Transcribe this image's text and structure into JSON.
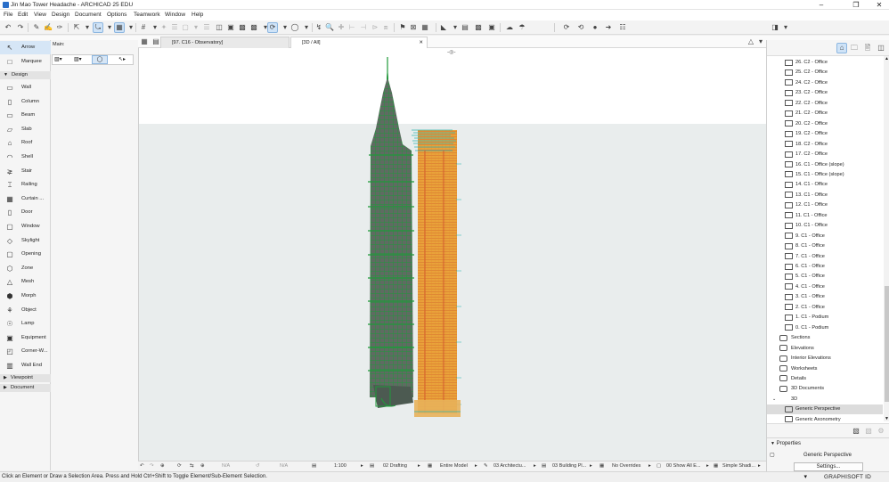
{
  "window": {
    "title": "Jin Mao Tower Headache - ARCHICAD 25 EDU",
    "controls": [
      "minimize",
      "maximize",
      "close"
    ]
  },
  "menu": [
    "File",
    "Edit",
    "View",
    "Design",
    "Document",
    "Options",
    "Teamwork",
    "Window",
    "Help"
  ],
  "tabs": [
    {
      "label": "[97. C16 - Observatory]",
      "active": false
    },
    {
      "label": "[3D / All]",
      "active": true
    }
  ],
  "toolbox": {
    "select_tools": [
      {
        "label": "Arrow",
        "icon": "arrow-icon",
        "selected": true
      },
      {
        "label": "Marquee",
        "icon": "marquee-icon",
        "selected": false
      }
    ],
    "design_header": "Design",
    "design_tools": [
      {
        "label": "Wall",
        "icon": "wall-icon"
      },
      {
        "label": "Column",
        "icon": "column-icon"
      },
      {
        "label": "Beam",
        "icon": "beam-icon"
      },
      {
        "label": "Slab",
        "icon": "slab-icon"
      },
      {
        "label": "Roof",
        "icon": "roof-icon"
      },
      {
        "label": "Shell",
        "icon": "shell-icon"
      },
      {
        "label": "Stair",
        "icon": "stair-icon"
      },
      {
        "label": "Railing",
        "icon": "railing-icon"
      },
      {
        "label": "Curtain ...",
        "icon": "curtain-wall-icon"
      },
      {
        "label": "Door",
        "icon": "door-icon"
      },
      {
        "label": "Window",
        "icon": "window-icon"
      },
      {
        "label": "Skylight",
        "icon": "skylight-icon"
      },
      {
        "label": "Opening",
        "icon": "opening-icon"
      },
      {
        "label": "Zone",
        "icon": "zone-icon"
      },
      {
        "label": "Mesh",
        "icon": "mesh-icon"
      },
      {
        "label": "Morph",
        "icon": "morph-icon"
      },
      {
        "label": "Object",
        "icon": "object-icon"
      },
      {
        "label": "Lamp",
        "icon": "lamp-icon"
      },
      {
        "label": "Equipment",
        "icon": "equipment-icon"
      },
      {
        "label": "Corner-W...",
        "icon": "corner-window-icon"
      },
      {
        "label": "Wall End",
        "icon": "wall-end-icon"
      }
    ],
    "viewpoint_header": "Viewpoint",
    "document_header": "Document"
  },
  "infobox": {
    "label": "Main:"
  },
  "navigator": {
    "stories": [
      "26. C2 - Office",
      "25. C2 - Office",
      "24. C2 - Office",
      "23. C2 - Office",
      "22. C2 - Office",
      "21. C2 - Office",
      "20. C2 - Office",
      "19. C2 - Office",
      "18. C2 - Office",
      "17. C2 - Office",
      "16. C1 - Office (slope)",
      "15. C1 - Office (slope)",
      "14. C1 - Office",
      "13. C1 - Office",
      "12. C1 - Office",
      "11. C1 - Office",
      "10. C1 - Office",
      "9. C1 - Office",
      "8. C1 - Office",
      "7. C1 - Office",
      "6. C1 - Office",
      "5. C1 - Office",
      "4. C1 - Office",
      "3. C1 - Office",
      "2. C1 - Office",
      "1. C1 - Podium",
      "0. C1 - Podium"
    ],
    "groups": [
      "Sections",
      "Elevations",
      "Interior Elevations",
      "Worksheets",
      "Details",
      "3D Documents",
      "3D"
    ],
    "views_3d": [
      {
        "label": "Generic Perspective",
        "selected": true
      },
      {
        "label": "Generic Axonometry",
        "selected": false
      }
    ]
  },
  "properties": {
    "header": "Properties",
    "value": "Generic Perspective",
    "settings_label": "Settings..."
  },
  "viewbar": {
    "scale_na_1": "N/A",
    "scale_na_2": "N/A",
    "scale": "1:100",
    "layer_combo": "02 Drafting",
    "model_view": "Entire Model",
    "pen_set": "03 Architectu...",
    "mvo": "03 Building Pl...",
    "override": "No Overrides",
    "renovation": "00 Show All E...",
    "shading": "Simple Shadi..."
  },
  "status": {
    "message": "Click an Element or Draw a Selection Area. Press and Hold Ctrl+Shift to Toggle Element/Sub-Element Selection.",
    "graphisoft_id": "GRAPHISOFT ID"
  },
  "colors": {
    "selection_blue": "#d6e6f6",
    "canvas_sky": "#ffffff",
    "canvas_ground": "#e6ebeb",
    "tower_green": "#1f9a3a",
    "tower_orange": "#e9a23a",
    "tower_cyan": "#2fb5b0"
  }
}
